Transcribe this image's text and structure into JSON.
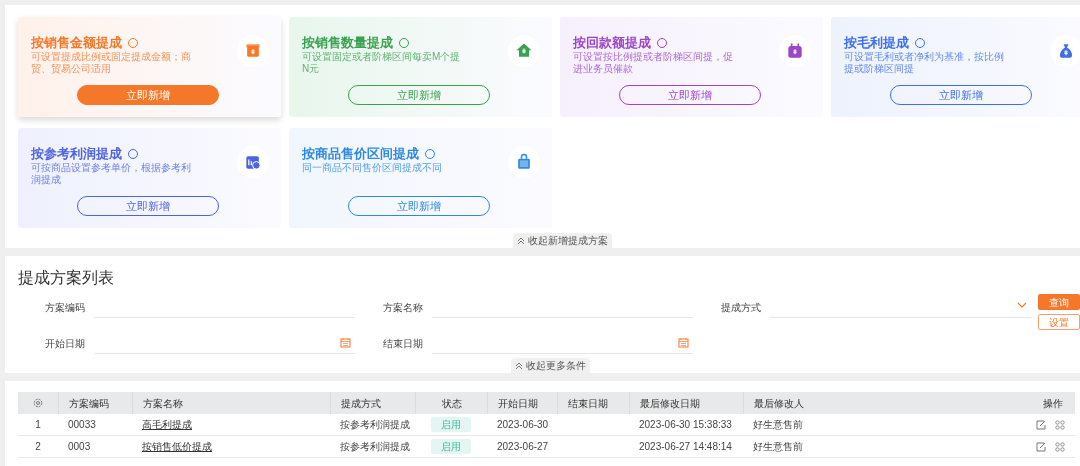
{
  "plans": [
    {
      "title": "按销售金额提成",
      "desc": "可设置提成比例或固定提成金额；商贸、贸易公司适用",
      "button": "立即新增",
      "color": "#f5782a",
      "selected": true
    },
    {
      "title": "按销售数量提成",
      "desc": "可设置固定或者阶梯区间每卖M个提N元",
      "button": "立即新增",
      "color": "#3aa14f",
      "selected": false
    },
    {
      "title": "按回款额提成",
      "desc": "可设置按比例提或者阶梯区间提，促进业务员催款",
      "button": "立即新增",
      "color": "#9b45c9",
      "selected": false
    },
    {
      "title": "按毛利提成",
      "desc": "可设置毛利或者净利为基准，按比例提或阶梯区间提",
      "button": "立即新增",
      "color": "#3f6ee8",
      "selected": false
    },
    {
      "title": "按参考利润提成",
      "desc": "可按商品设置参考单价，根据参考利润提成",
      "button": "立即新增",
      "color": "#4f62e0",
      "selected": false
    },
    {
      "title": "按商品售价区间提成",
      "desc": "同一商品不同售价区间提成不同",
      "button": "立即新增",
      "color": "#2d8ae0",
      "selected": false
    }
  ],
  "collapse_plans": "收起新增提成方案",
  "list_title": "提成方案列表",
  "filters": [
    {
      "label": "方案编码",
      "kind": "text"
    },
    {
      "label": "方案名称",
      "kind": "text"
    },
    {
      "label": "提成方式",
      "kind": "select"
    },
    {
      "label": "开始日期",
      "kind": "date"
    },
    {
      "label": "结束日期",
      "kind": "date"
    }
  ],
  "query_button": "查询",
  "settings_button": "设置",
  "collapse_filters": "收起更多条件",
  "table": {
    "columns": [
      "方案编码",
      "方案名称",
      "提成方式",
      "状态",
      "开始日期",
      "结束日期",
      "最后修改日期",
      "最后修改人",
      "操作"
    ],
    "rows": [
      {
        "index": "1",
        "code": "00033",
        "name": "高毛利提成",
        "method": "按参考利润提成",
        "status": "启用",
        "start": "2023-06-30",
        "modified": "2023-06-30 15:38:33",
        "modifier": "好生意售前"
      },
      {
        "index": "2",
        "code": "0003",
        "name": "按销售低价提成",
        "method": "按参考利润提成",
        "status": "启用",
        "start": "2023-06-27",
        "modified": "2023-06-27 14:48:14",
        "modifier": "好生意售前"
      }
    ]
  }
}
